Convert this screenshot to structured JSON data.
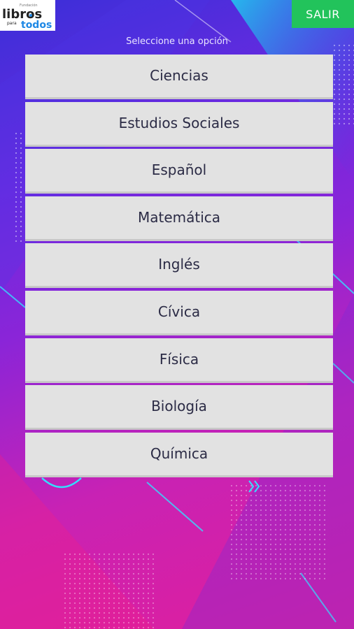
{
  "logo": {
    "line1": "Fundación",
    "line2": "libros",
    "line3": "para",
    "line4": "todos"
  },
  "header": {
    "exit_label": "SALIR"
  },
  "prompt": "Seleccione una opción",
  "subjects": [
    {
      "label": "Ciencias"
    },
    {
      "label": "Estudios Sociales"
    },
    {
      "label": "Español"
    },
    {
      "label": "Matemática"
    },
    {
      "label": "Inglés"
    },
    {
      "label": "Cívica"
    },
    {
      "label": "Física"
    },
    {
      "label": "Biología"
    },
    {
      "label": "Química"
    }
  ],
  "colors": {
    "exit_button": "#22c35b",
    "menu_item_bg": "#e2e2e2",
    "menu_text": "#2b2b45"
  }
}
